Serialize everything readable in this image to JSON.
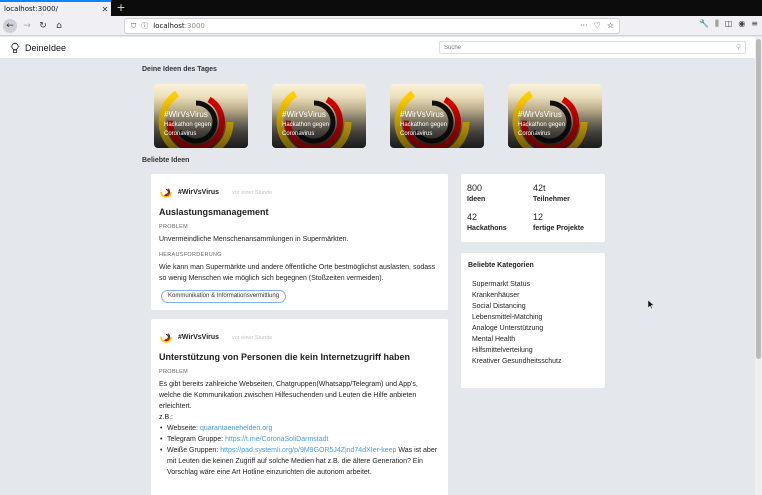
{
  "browser": {
    "tab_title": "localhost:3000/",
    "url_host": "localhost",
    "url_rest": ":3000",
    "icons": [
      "back-icon",
      "forward-icon",
      "reload-icon",
      "home-icon",
      "shield-icon",
      "info-icon",
      "more-icon",
      "pocket-icon",
      "bookmark-star-icon",
      "wrench-icon",
      "library-icon",
      "sidebar-icon",
      "account-icon",
      "menu-icon"
    ]
  },
  "header": {
    "brand": "DeineIdee",
    "search_placeholder": "Suche"
  },
  "sections": {
    "ideas_of_day": "Deine Ideen des Tages",
    "popular_ideas": "Beliebte Ideen"
  },
  "tiles": [
    {
      "title": "#WirVsVirus",
      "subtitle": "Hackathon gegen Coronavirus"
    },
    {
      "title": "#WirVsVirus",
      "subtitle": "Hackathon gegen Coronavirus"
    },
    {
      "title": "#WirVsVirus",
      "subtitle": "Hackathon gegen Coronavirus"
    },
    {
      "title": "#WirVsVirus",
      "subtitle": "Hackathon gegen Coronavirus"
    }
  ],
  "ideas": [
    {
      "group": "#WirVsVirus",
      "time": "vor einer Stunde",
      "title": "Auslastungsmanagement",
      "problem_label": "PROBLEM",
      "problem": "Unvermeindliche Menschenansammlungen in Supermärkten.",
      "challenge_label": "HERAUSFORDERUNG",
      "challenge": "Wie kann man Supermärkte und andere öffentliche Orte bestmöglichst auslasten, sodass so wenig Menschen wie möglich sich begegnen (Stoßzeiten vermeiden).",
      "tag": "Kommunikation & Informationsvermittlung"
    },
    {
      "group": "#WirVsVirus",
      "time": "vor einer Stunde",
      "title": "Unterstützung von Personen die kein Internetzugriff haben",
      "problem_label": "PROBLEM",
      "problem": "Es gibt bereits zahlreiche Webseiten, Chatgruppen(Whatsapp/Telegram) und App's, welche die Kommunikation zwischen Hilfesuchenden und Leuten die Hilfe anbieten erleichtert.",
      "example": "z.B.:",
      "items": [
        {
          "label": "Webseite: ",
          "link": "quarantaenehelden.org",
          "rest": ""
        },
        {
          "label": "Telegram Gruppe: ",
          "link": "https://t.me/CoronaSoliDarmstadt",
          "rest": ""
        },
        {
          "label": "Weiße Gruppen: ",
          "link": "https://pad.systemli.org/p/9M9GOR5J4Zjnd74dXIer-keep",
          "rest": " Was ist aber mit Leuten die keinen Zugriff auf solche Medien hat z.B. die ältere Generation? Ein Vorschlag wäre eine Art Hotline einzurichten die autonom arbeitet."
        }
      ]
    }
  ],
  "stats": [
    {
      "value": "800",
      "label": "Ideen"
    },
    {
      "value": "42t",
      "label": "Teilnehmer"
    },
    {
      "value": "42",
      "label": "Hackathons"
    },
    {
      "value": "12",
      "label": "fertige Projekte"
    }
  ],
  "categories": {
    "title": "Beliebte Kategorien",
    "items": [
      "Supermarkt Status",
      "Krankenhäuser",
      "Social Distancing",
      "Lebensmittel-Matching",
      "Analoge Unterstützung",
      "Mental Health",
      "Hilfsmittelverteilung",
      "Kreativer Gesundheitsschutz"
    ]
  },
  "colors": {
    "accent": "#0a84ff",
    "link": "#4a9bd9",
    "tag_border": "#7fb2e5",
    "flag_black": "#111111",
    "flag_red": "#dd0000",
    "flag_gold": "#ffce00"
  }
}
